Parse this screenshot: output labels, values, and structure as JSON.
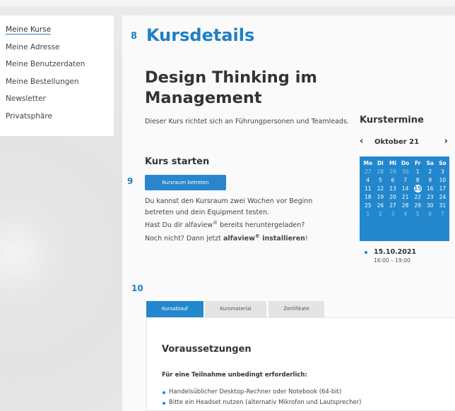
{
  "sidebar": {
    "items": [
      {
        "label": "Meine Kurse",
        "active": true
      },
      {
        "label": "Meine Adresse"
      },
      {
        "label": "Meine Benutzerdaten"
      },
      {
        "label": "Meine Bestellungen"
      },
      {
        "label": "Newsletter"
      },
      {
        "label": "Privatsphäre"
      }
    ]
  },
  "annotations": {
    "n8": "8",
    "n9": "9",
    "n10": "10"
  },
  "page": {
    "title": "Kursdetails"
  },
  "course": {
    "title": "Design Thinking im Management",
    "description": "Dieser Kurs richtet sich an Führungpersonen und Teamleads."
  },
  "start": {
    "heading": "Kurs starten",
    "button_label": "Kursraum betreten",
    "info_line1": "Du kannst den Kursraum zwei Wochen vor Beginn",
    "info_line2": "betreten und dein Equipment testen.",
    "info_line3_pre": "Hast Du dir alfaview",
    "info_line3_post": " bereits heruntergeladen?",
    "info_line4_pre": "Noch nicht? Dann jetzt ",
    "info_link_pre": "alfaview",
    "info_link_post": " installieren",
    "info_line4_end": "!",
    "reg_mark": "®"
  },
  "calendar": {
    "heading": "Kurstermine",
    "month": "Oktober 21",
    "prev": "‹",
    "next": "›",
    "weekdays": [
      "Mo",
      "Di",
      "Mi",
      "Do",
      "Fr",
      "Sa",
      "So"
    ],
    "weeks": [
      [
        "27",
        "28",
        "29",
        "30",
        "1",
        "2",
        "3"
      ],
      [
        "4",
        "5",
        "6",
        "7",
        "8",
        "9",
        "10"
      ],
      [
        "11",
        "12",
        "13",
        "14",
        "15",
        "16",
        "17"
      ],
      [
        "18",
        "19",
        "20",
        "21",
        "22",
        "23",
        "24"
      ],
      [
        "25",
        "26",
        "27",
        "28",
        "29",
        "30",
        "31"
      ],
      [
        "1",
        "2",
        "3",
        "4",
        "5",
        "6",
        "7"
      ]
    ],
    "today": "15",
    "accent": "#2387cd"
  },
  "event": {
    "date": "15.10.2021",
    "time": "16:00 – 19:00"
  },
  "tabs": [
    {
      "label": "Kursablauf",
      "active": true
    },
    {
      "label": "Kursmaterial"
    },
    {
      "label": "Zertifikate"
    }
  ],
  "requirements": {
    "heading": "Voraussetzungen",
    "subheading": "Für eine Teilnahme unbedingt erforderlich:",
    "items": [
      "Handelsüblicher Desktop-Rechner oder Notebook (64-bit)",
      "Bitte ein Headset nutzen (alternativ Mikrofon und Lautsprecher)"
    ]
  }
}
